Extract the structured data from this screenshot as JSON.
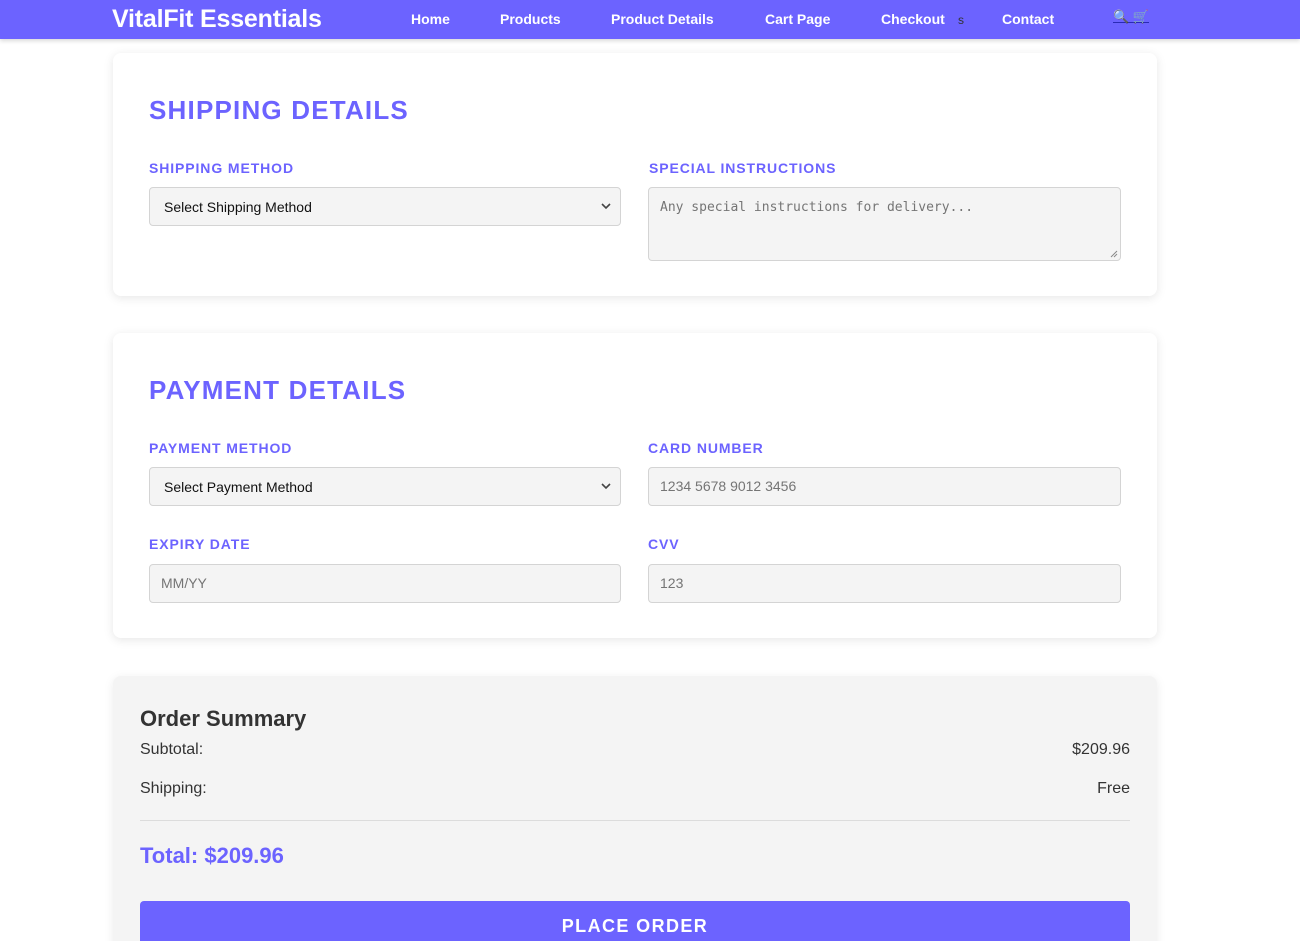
{
  "header": {
    "brand": "VitalFit Essentials",
    "nav": [
      "Home",
      "Products",
      "Product Details",
      "Cart Page",
      "Checkout",
      "Contact"
    ],
    "stray_text": "s",
    "icons": [
      "search-icon",
      "cart-icon"
    ],
    "icons_text": "🔍 🛒"
  },
  "shipping": {
    "title": "SHIPPING DETAILS",
    "method_label": "SHIPPING METHOD",
    "method_value": "Select Shipping Method",
    "instructions_label": "SPECIAL INSTRUCTIONS",
    "instructions_placeholder": "Any special instructions for delivery..."
  },
  "payment": {
    "title": "PAYMENT DETAILS",
    "method_label": "PAYMENT METHOD",
    "method_value": "Select Payment Method",
    "card_label": "CARD NUMBER",
    "card_placeholder": "1234 5678 9012 3456",
    "expiry_label": "EXPIRY DATE",
    "expiry_placeholder": "MM/YY",
    "cvv_label": "CVV",
    "cvv_placeholder": "123"
  },
  "summary": {
    "title": "Order Summary",
    "subtotal_label": "Subtotal:",
    "subtotal_value": "$209.96",
    "shipping_label": "Shipping:",
    "shipping_value": "Free",
    "total": "Total: $209.96",
    "button": "PLACE ORDER"
  },
  "colors": {
    "accent": "#6c63ff",
    "field_bg": "#f4f4f4",
    "summary_bg": "#f4f4f4"
  }
}
